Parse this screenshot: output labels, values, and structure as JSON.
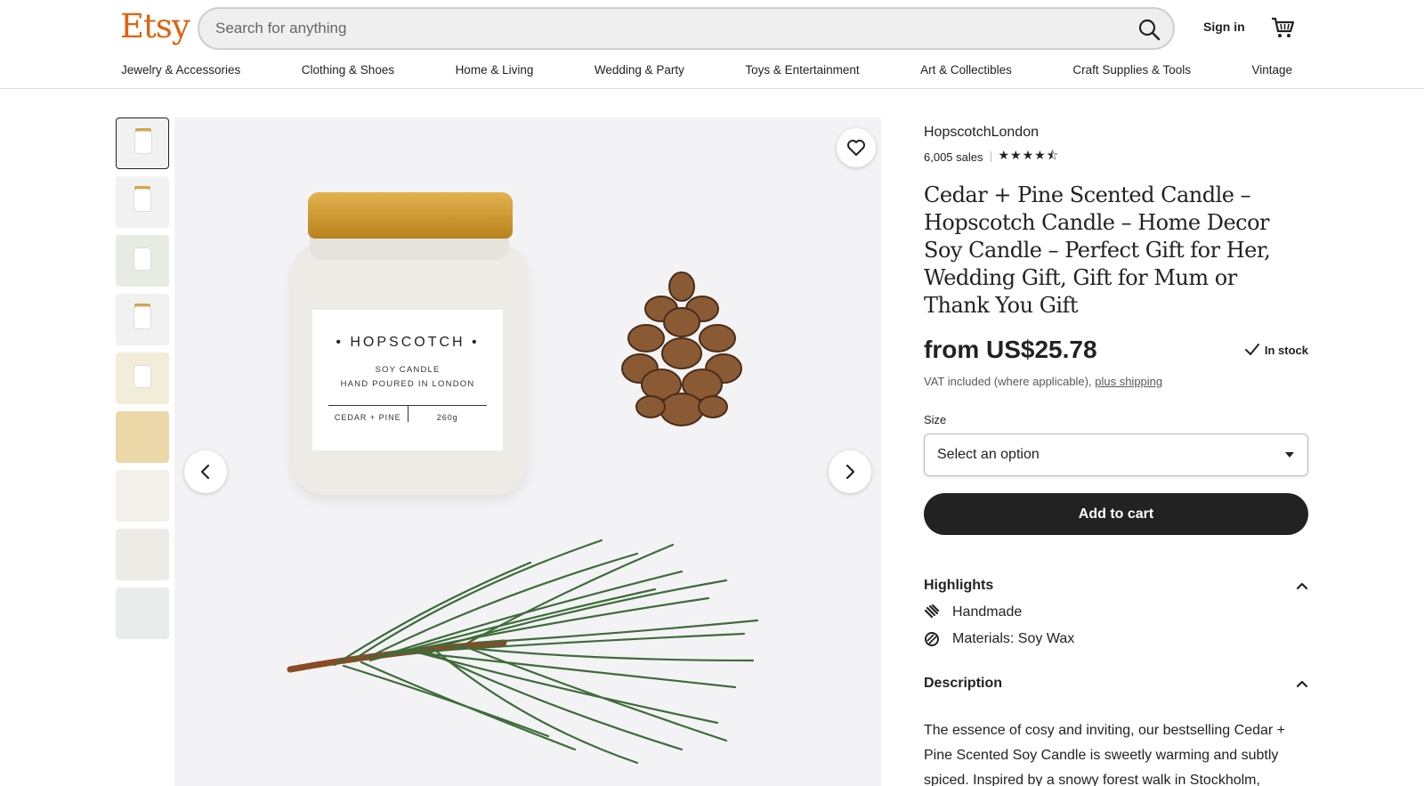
{
  "header": {
    "logo": "Etsy",
    "search_placeholder": "Search for anything",
    "sign_in": "Sign in",
    "icons": {
      "search": "search-icon",
      "cart": "cart-icon"
    }
  },
  "nav": [
    "Jewelry & Accessories",
    "Clothing & Shoes",
    "Home & Living",
    "Wedding & Party",
    "Toys & Entertainment",
    "Art & Collectibles",
    "Craft Supplies & Tools",
    "Vintage"
  ],
  "gallery": {
    "thumbnail_count": 9,
    "label": {
      "brand": "• HOPSCOTCH •",
      "line1": "SOY CANDLE",
      "line2": "HAND POURED IN LONDON",
      "scent": "CEDAR + PINE",
      "weight": "260g"
    }
  },
  "product": {
    "shop_name": "HopscotchLondon",
    "sales": "6,005 sales",
    "rating_stars": "★★★★⯪",
    "title": "Cedar + Pine Scented Candle – Hopscotch Candle – Home Decor Soy Candle – Perfect Gift for Her, Wedding Gift, Gift for Mum or Thank You Gift",
    "price": "from US$25.78",
    "stock": "In stock",
    "vat_text": "VAT included (where applicable),",
    "shipping_link": "plus shipping",
    "size_label": "Size",
    "size_select": "Select an option",
    "add_to_cart": "Add to cart"
  },
  "highlights": {
    "heading": "Highlights",
    "items": [
      {
        "icon": "hand-icon",
        "text": "Handmade"
      },
      {
        "icon": "materials-icon",
        "text": "Materials: Soy Wax"
      }
    ]
  },
  "description": {
    "heading": "Description",
    "text": "The essence of cosy and inviting, our bestselling Cedar + Pine Scented Soy Candle is sweetly warming and subtly spiced. Inspired by a snowy forest walk in Stockholm, stumbling across a hidden bakery and"
  },
  "colors": {
    "brand": "#e1620f",
    "button_dark": "#222222"
  }
}
